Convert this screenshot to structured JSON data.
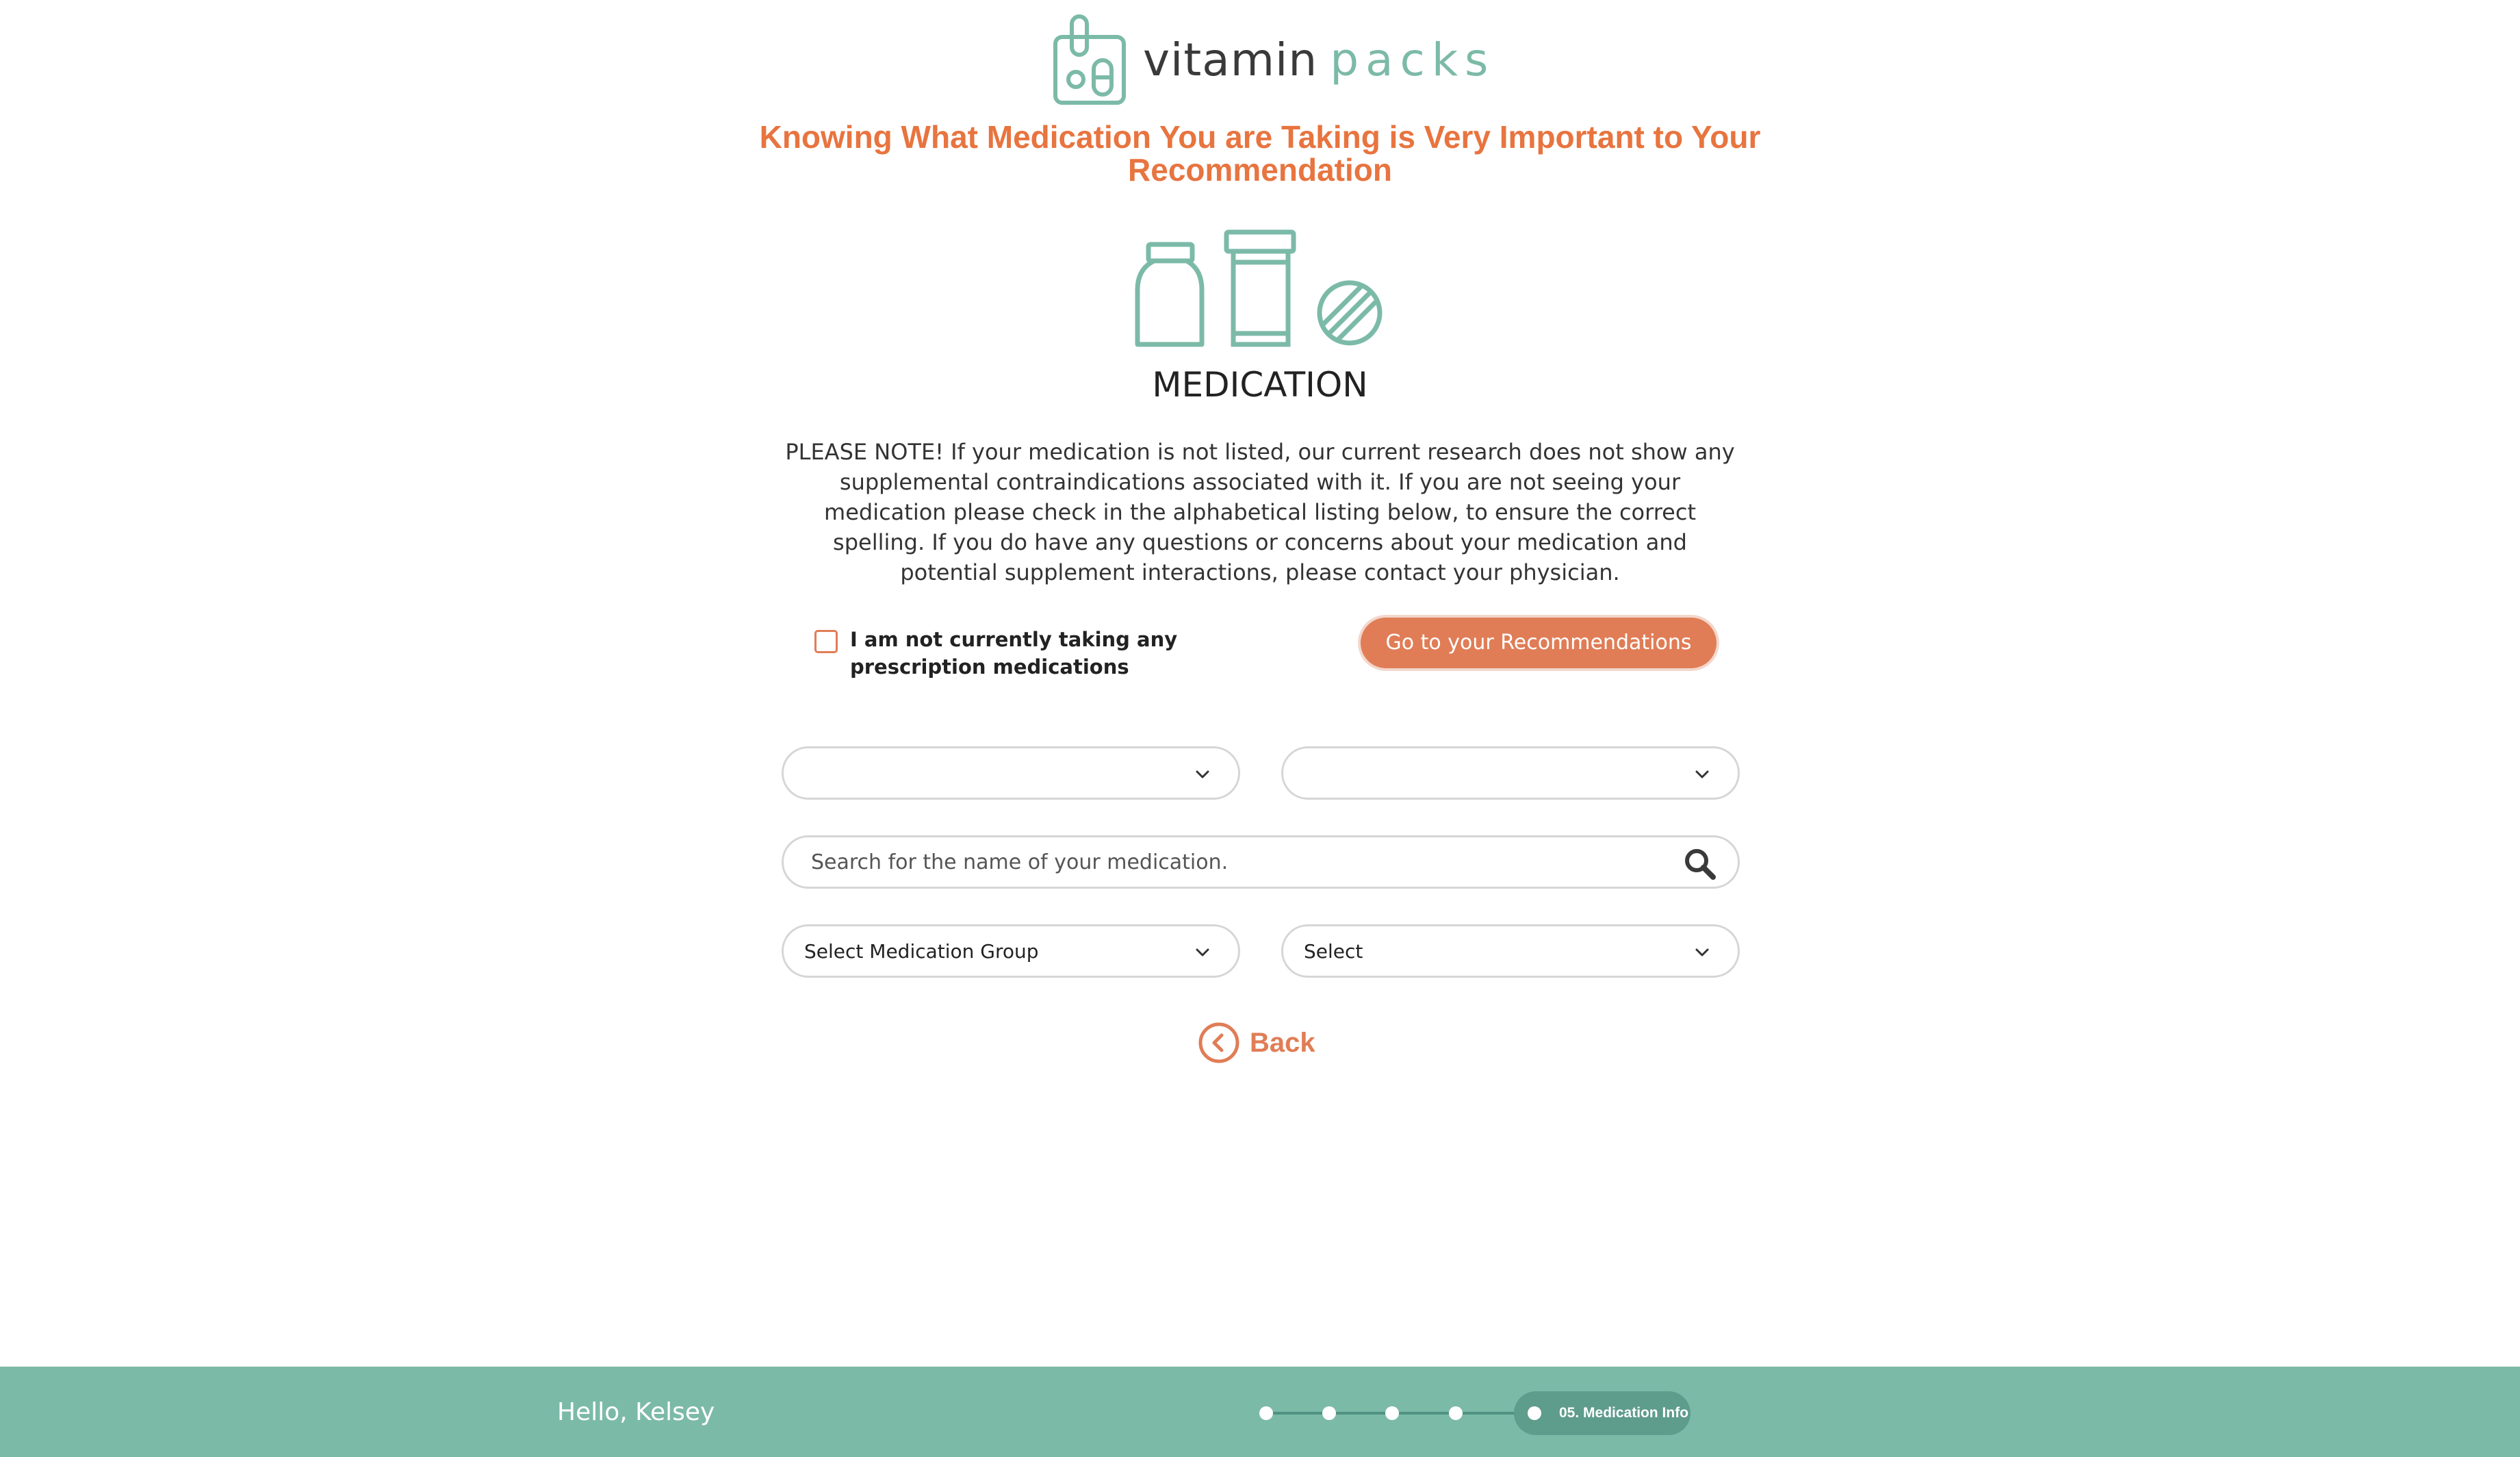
{
  "brand": {
    "word1": "vitamin",
    "word2": "packs",
    "logo_icon": "pill-bottle-logo-icon",
    "accent_color": "#e8743f",
    "teal_color": "#7cbaa8"
  },
  "headline": "Knowing What Medication You are Taking is Very Important to Your Recommendation",
  "section_icon": "medication-bottles-icon",
  "section_title": "MEDICATION",
  "note": "PLEASE NOTE! If your medication is not listed, our current research does not show any supplemental contraindications associated with it. If you are not seeing your medication please check in the alphabetical listing below, to ensure the correct spelling. If you do have any questions or concerns about your medication and potential supplement interactions, please contact your physician.",
  "optout": {
    "label": "I am not currently taking any prescription medications",
    "checked": false
  },
  "recommendations_button": "Go to your Recommendations",
  "dropdowns": {
    "top_left": "",
    "top_right": "",
    "medication_group": "Select Medication Group",
    "medication": "Select"
  },
  "search": {
    "placeholder": "Search for the name of your medication.",
    "value": ""
  },
  "back_label": "Back",
  "footer": {
    "greeting": "Hello, Kelsey",
    "progress": {
      "completed_steps": 4,
      "current_step_label": "05. Medication Info"
    }
  }
}
